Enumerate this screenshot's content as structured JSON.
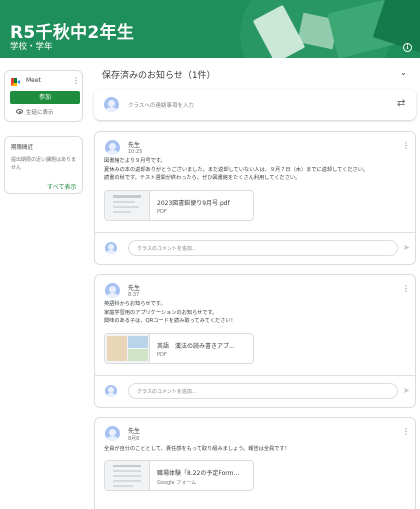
{
  "header": {
    "class_title": "R5千秋中2年生",
    "class_subtitle": "学校・学年",
    "info_icon": "info-icon"
  },
  "meet": {
    "label": "Meet",
    "join_label": "参加",
    "visibility_label": "生徒に表示"
  },
  "due": {
    "title": "期限間近",
    "text": "提出期限の近い課題はありません",
    "view_all": "すべて表示"
  },
  "stream": {
    "saved_header": "保存済みのお知らせ（1件）",
    "share_placeholder": "クラスへの連絡事項を入力"
  },
  "posts": [
    {
      "author": "先生",
      "date": "10:25",
      "body": [
        "図書館だより９月号です。",
        "夏休みの本の返却ありがとうございました。まだ返却していない人は、９月７日（木）までに返却してください。",
        "読書の秋です。テスト週間が終わったら、ぜひ図書館をたくさん利用してください。"
      ],
      "attachment": {
        "name": "2023図書館便り9月号.pdf",
        "type": "PDF"
      },
      "comment_placeholder": "クラスのコメントを追加..."
    },
    {
      "author": "先生",
      "date": "8:37",
      "body": [
        "英語科からお知らせです。",
        "家庭学習用のアプリケーションのお知らせです。",
        "興味のある子は、QRコードを読み取ってみてください！"
      ],
      "attachment": {
        "name": "英語　漢法の読み書きアプ...",
        "type": "PDF"
      },
      "comment_placeholder": "クラスのコメントを追加..."
    },
    {
      "author": "先生",
      "date": "8月8",
      "body": [
        "全員が自分のこととして、責任感をもって取り組みましょう。報告は全員です！"
      ],
      "attachment": {
        "name": "職場体験「8.22の予定Form...",
        "type": "Google フォーム"
      }
    }
  ]
}
